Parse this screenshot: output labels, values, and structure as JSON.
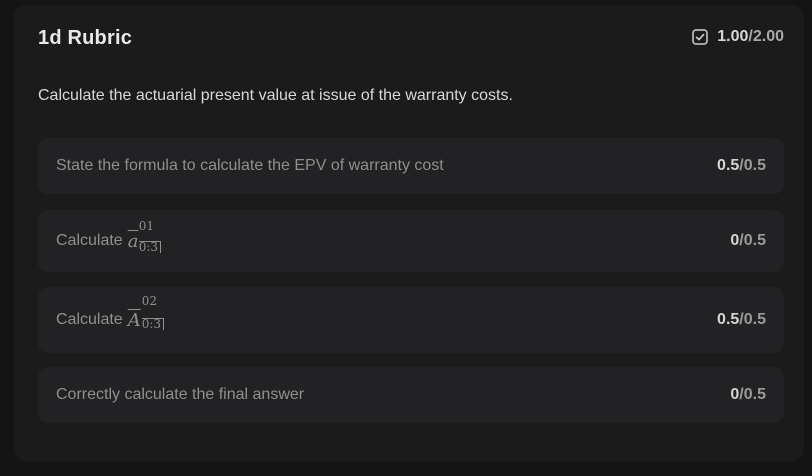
{
  "rubric": {
    "title": "1d Rubric",
    "score": {
      "earned": "1.00",
      "separator": "/",
      "max": "2.00",
      "icon": "checkbox-check-icon"
    },
    "question": "Calculate the actuarial present value at issue of the warranty costs.",
    "criteria": [
      {
        "label": "State the formula to calculate the EPV of warranty cost",
        "earned": "0.5",
        "max": "0.5"
      },
      {
        "label": "Calculate",
        "math": {
          "base": "a",
          "sup": "01",
          "sub": "0:3"
        },
        "earned": "0",
        "max": "0.5"
      },
      {
        "label": "Calculate",
        "math": {
          "base": "A",
          "sup": "02",
          "sub": "0:3"
        },
        "earned": "0.5",
        "max": "0.5"
      },
      {
        "label": "Correctly calculate the final answer",
        "earned": "0",
        "max": "0.5"
      }
    ]
  }
}
